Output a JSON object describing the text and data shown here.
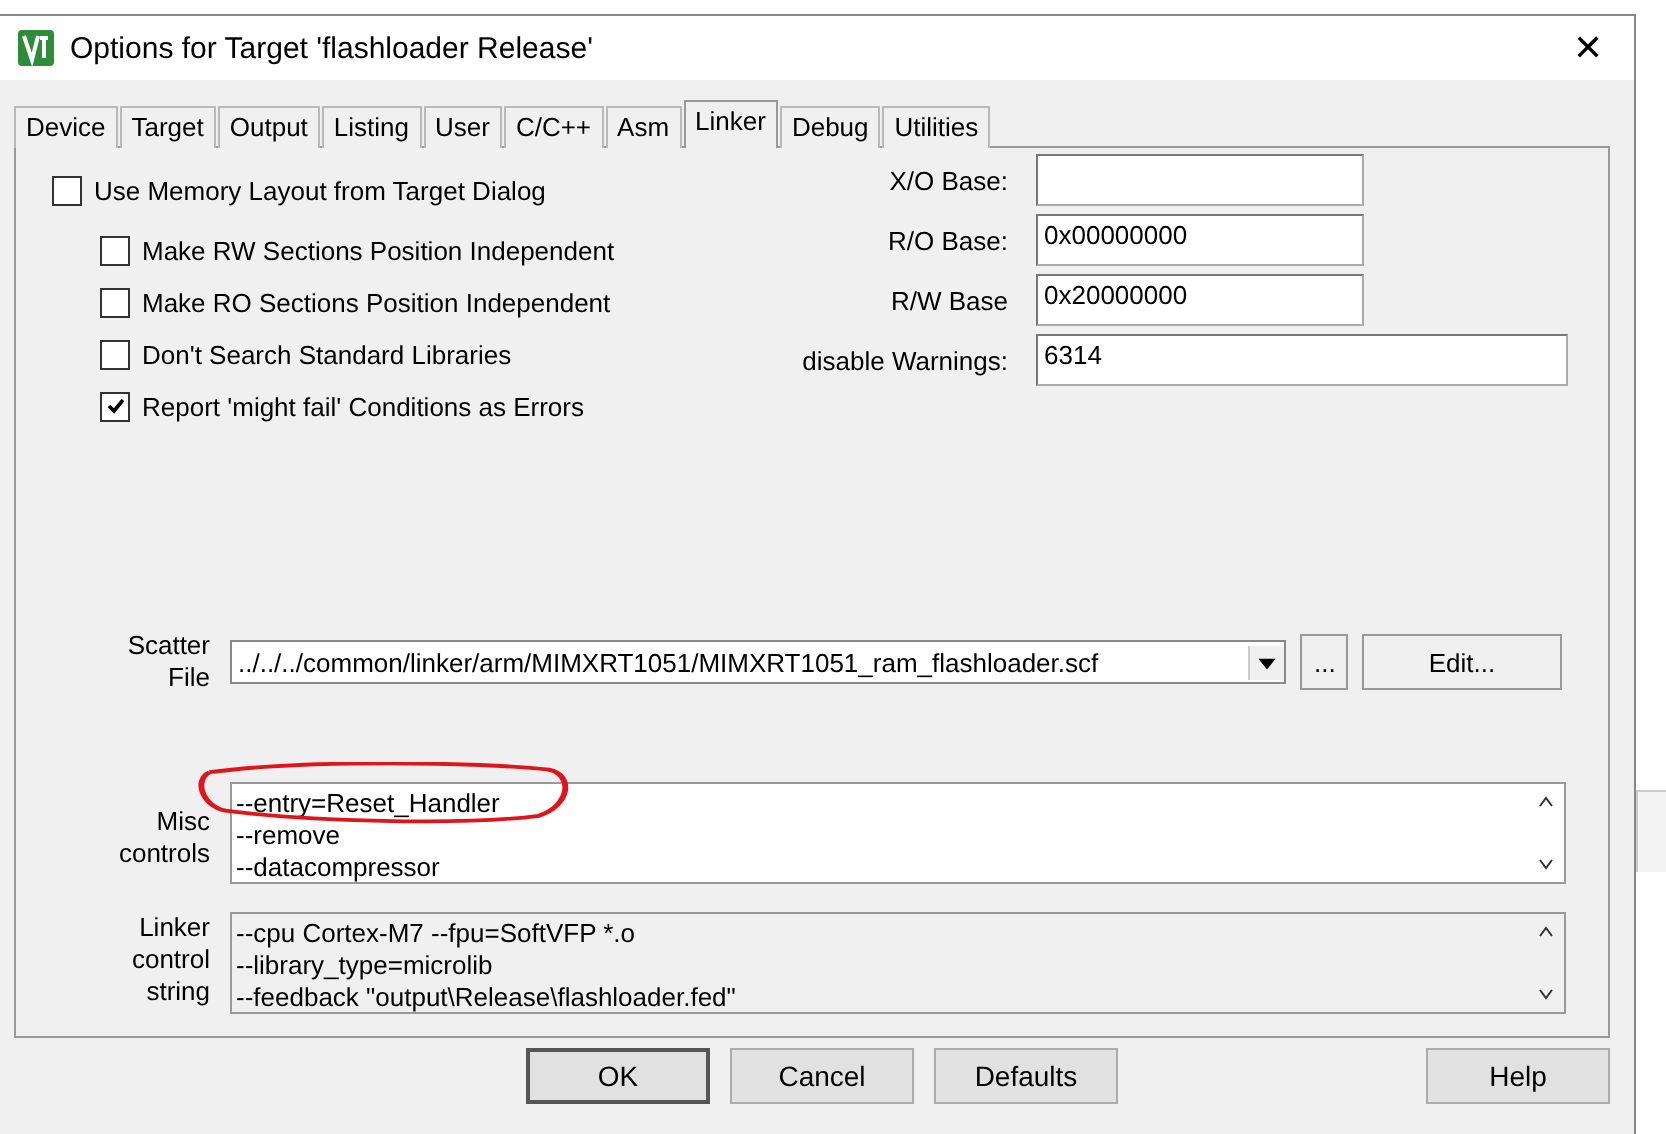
{
  "window": {
    "title": "Options for Target 'flashloader Release'",
    "close": "✕"
  },
  "tabs": [
    {
      "label": "Device",
      "selected": false
    },
    {
      "label": "Target",
      "selected": false
    },
    {
      "label": "Output",
      "selected": false
    },
    {
      "label": "Listing",
      "selected": false
    },
    {
      "label": "User",
      "selected": false
    },
    {
      "label": "C/C++",
      "selected": false
    },
    {
      "label": "Asm",
      "selected": false
    },
    {
      "label": "Linker",
      "selected": true
    },
    {
      "label": "Debug",
      "selected": false
    },
    {
      "label": "Utilities",
      "selected": false
    }
  ],
  "options": [
    {
      "label": "Use Memory Layout from Target Dialog",
      "checked": false,
      "indented": false
    },
    {
      "label": "Make RW Sections Position Independent",
      "checked": false,
      "indented": true
    },
    {
      "label": "Make RO Sections Position Independent",
      "checked": false,
      "indented": true
    },
    {
      "label": "Don't Search Standard Libraries",
      "checked": false,
      "indented": true
    },
    {
      "label": "Report 'might fail' Conditions as Errors",
      "checked": true,
      "indented": true
    }
  ],
  "fields": [
    {
      "label": "X/O Base:",
      "wide": false
    },
    {
      "label": "R/O Base:",
      "value": "0x00000000",
      "wide": false
    },
    {
      "label": "R/W Base",
      "value": "0x20000000",
      "wide": false
    },
    {
      "label": "disable Warnings:",
      "value": "6314",
      "wide": true
    }
  ],
  "scatter": {
    "label": [
      "Scatter",
      "File"
    ],
    "value": "../../../common/linker/arm/MIMXRT1051/MIMXRT1051_ram_flashloader.scf",
    "browse": "...",
    "edit": "Edit..."
  },
  "misc": {
    "label": [
      "Misc",
      "controls"
    ],
    "lines": [
      "--entry=Reset_Handler",
      "--remove",
      "--datacompressor"
    ],
    "highlighted": true
  },
  "linker_string": {
    "label": [
      "Linker",
      "control",
      "string"
    ],
    "lines": [
      "--cpu Cortex-M7 --fpu=SoftVFP *.o",
      "--library_type=microlib",
      "--feedback \"output\\Release\\flashloader.fed\""
    ]
  },
  "buttons": [
    {
      "label": "OK",
      "default": true
    },
    {
      "label": "Cancel",
      "default": false
    },
    {
      "label": "Defaults",
      "default": false
    },
    {
      "label": "Help",
      "default": false
    }
  ]
}
